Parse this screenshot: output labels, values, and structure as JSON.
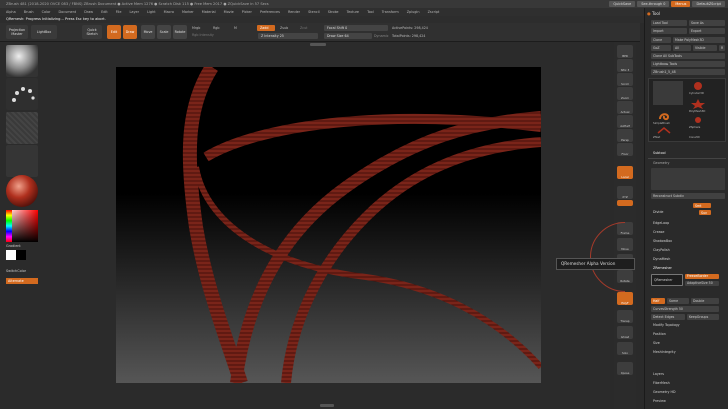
{
  "window": {
    "title": "ZBrush 481 (2018-2020 OVCE 083 / FBNS)    ZBrush Document    ● Active Mem 1276 ● Scratch Disk 115 ● Free Mem 2017 ● ZQuickSave in 57 Secs",
    "quicksave": "QuickSave",
    "seethrough": "See-through  0",
    "menus": "Menus",
    "default_script": "DefaultZScript"
  },
  "menubar": {
    "items": [
      "Alpha",
      "Brush",
      "Color",
      "Document",
      "Draw",
      "Edit",
      "File",
      "Layer",
      "Light",
      "Macro",
      "Marker",
      "Material",
      "Movie",
      "Picker",
      "Preferences",
      "Render",
      "Stencil",
      "Stroke",
      "Texture",
      "Tool",
      "Transform",
      "Zplugin",
      "Zscript"
    ]
  },
  "status": {
    "text": "QRemesh: Progress Initializing...  Press Esc key to abort."
  },
  "topshelf": {
    "projection_master": "Projection Master",
    "lightbox": "LightBox",
    "quick_sketch": "Quick Sketch",
    "edit": "Edit",
    "draw": "Draw",
    "move": "Move",
    "scale": "Scale",
    "rotate": "Rotate",
    "mrgb": "Mrgb",
    "rgb": "Rgb",
    "m": "M",
    "rgb_intensity": "Rgb Intensity",
    "zadd": "Zadd",
    "zsub": "Zsub",
    "zcut": "Zcut",
    "z_intensity": "Z Intensity 25",
    "focal_shift": "Focal Shift 0",
    "draw_size": "Draw Size 64",
    "dynamic": "Dynamic",
    "active_points": "ActivePoints: 298,424",
    "total_points": "TotalPoints: 298,424"
  },
  "lefttray": {
    "gradient": "Gradient",
    "switch_color": "SwitchColor",
    "alternate": "Alternate"
  },
  "rightshelf": {
    "buttons": [
      "BPR",
      "SPix 3",
      "Scroll",
      "Zoom",
      "Actual",
      "AAHalf",
      "Persp",
      "Floor",
      "Local",
      "XYZ",
      "Frame",
      "Move",
      "Scale",
      "Rotate",
      "PolyF",
      "Transp",
      "Ghost",
      "Solo",
      "Xpose"
    ]
  },
  "tooltip": {
    "text": "QRemesher  Alpha  Version"
  },
  "toolpalette": {
    "title": "Tool",
    "load_tool": "Load Tool",
    "save_as": "Save As",
    "import": "Import",
    "export": "Export",
    "clone": "Clone",
    "make_polymesh": "Make PolyMesh3D",
    "goz": "GoZ",
    "all": "All",
    "visible": "Visible",
    "r": "R",
    "clone_all_subtools": "Clone All SubTools",
    "lightbox_tools": "Lightbox▸ Tools",
    "current_tool": "ZBrush1_5_48",
    "tools": [
      "ZBrush1_5_48",
      "Cylinder3D",
      "PolyMesh3D",
      "SimpleBrush",
      "Sphere3D",
      "ZSphere",
      "ZTest",
      "Cone3D"
    ],
    "subtool": "Subtool",
    "geometry": "Geometry",
    "reconstruct_subdiv": "Reconstruct Subdiv",
    "divide": "Divide",
    "smt": "Smt",
    "suv": "Suv",
    "edgeloop": "EdgeLoop",
    "crease": "Crease",
    "shadowbox": "ShadowBox",
    "claypolish": "ClayPolish",
    "dynamesh": "DynaMesh",
    "zremesher": "ZRemesher",
    "zremesher_btn": "QRemesher",
    "freeze": "FreezeBorder",
    "freeze_groups": "FreezeGroups",
    "adaptive": "Adaptive",
    "adaptive_size": "AdaptiveSize 50",
    "target_polygons": "Target Polygons Count 5",
    "half": "Half",
    "same": "Same",
    "double": "Double",
    "curves_strength": "CurvesStrength 50",
    "use_polypaint": "Use Polypaint",
    "detect_edges": "Detect Edges",
    "keep_groups": "KeepGroups",
    "modify_topology": "Modify Topology",
    "position": "Position",
    "size": "Size",
    "meshintegrity": "MeshIntegrity",
    "layers": "Layers",
    "fibermesh": "FiberMesh",
    "geometry_hd": "Geometry HD",
    "preview": "Preview"
  },
  "colors": {
    "accent": "#d36a1f",
    "mesh": "#7a2419",
    "panel": "#2a2a2a"
  }
}
